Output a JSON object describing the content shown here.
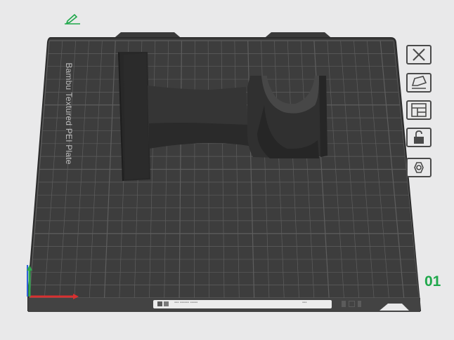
{
  "plate": {
    "label": "Bambu Textured PEI Plate",
    "number": "01"
  },
  "toolbar": {
    "buttons": [
      {
        "name": "close",
        "icon": "close-x-icon"
      },
      {
        "name": "arrange",
        "icon": "arrange-icon"
      },
      {
        "name": "layout",
        "icon": "layout-icon"
      },
      {
        "name": "lock",
        "icon": "unlock-icon"
      },
      {
        "name": "settings",
        "icon": "hexagon-nut-icon"
      }
    ]
  },
  "bottom_bar": {
    "left_text": "▪▪▪ ▪▪▪▪▪▪ ▪▪▪▪▪",
    "right_text": "▪▪▪"
  },
  "colors": {
    "background": "#e9e9ea",
    "plate": "#3d3d3d",
    "grid": "#5e5e5e",
    "model": "#2e2e2e",
    "accent_green": "#1fa84b",
    "axis_x": "#d83030",
    "axis_y": "#2fa84f",
    "axis_z": "#2f5fd8"
  }
}
